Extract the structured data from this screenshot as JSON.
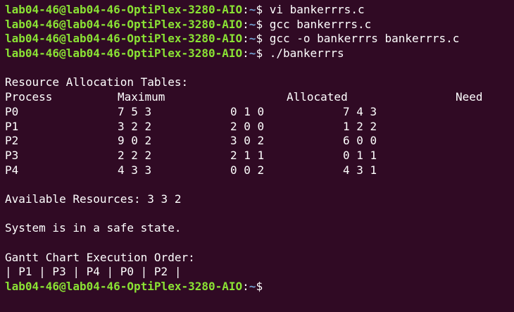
{
  "prompt": {
    "user_host": "lab04-46@lab04-46-OptiPlex-3280-AIO",
    "separator": ":",
    "path": "~",
    "dollar": "$"
  },
  "commands": [
    "vi bankerrrs.c",
    "gcc bankerrrs.c",
    "gcc -o bankerrrs bankerrrs.c",
    "./bankerrrs"
  ],
  "output": {
    "title": "Resource Allocation Tables:",
    "headers": {
      "process": "Process",
      "maximum": "Maximum",
      "allocated": "Allocated",
      "need": "Need"
    },
    "rows": [
      {
        "process": "P0",
        "maximum": "7 5 3",
        "allocated": "0 1 0",
        "need": "7 4 3"
      },
      {
        "process": "P1",
        "maximum": "3 2 2",
        "allocated": "2 0 0",
        "need": "1 2 2"
      },
      {
        "process": "P2",
        "maximum": "9 0 2",
        "allocated": "3 0 2",
        "need": "6 0 0"
      },
      {
        "process": "P3",
        "maximum": "2 2 2",
        "allocated": "2 1 1",
        "need": "0 1 1"
      },
      {
        "process": "P4",
        "maximum": "4 3 3",
        "allocated": "0 0 2",
        "need": "4 3 1"
      }
    ],
    "available": "Available Resources: 3 3 2",
    "safe_state": "System is in a safe state.",
    "gantt_title": "Gantt Chart Execution Order:",
    "gantt_chart": "| P1 | P3 | P4 | P0 | P2 |"
  },
  "colors": {
    "background": "#300a24",
    "prompt_user": "#8ae234",
    "prompt_path": "#729fcf",
    "text": "#ffffff"
  }
}
